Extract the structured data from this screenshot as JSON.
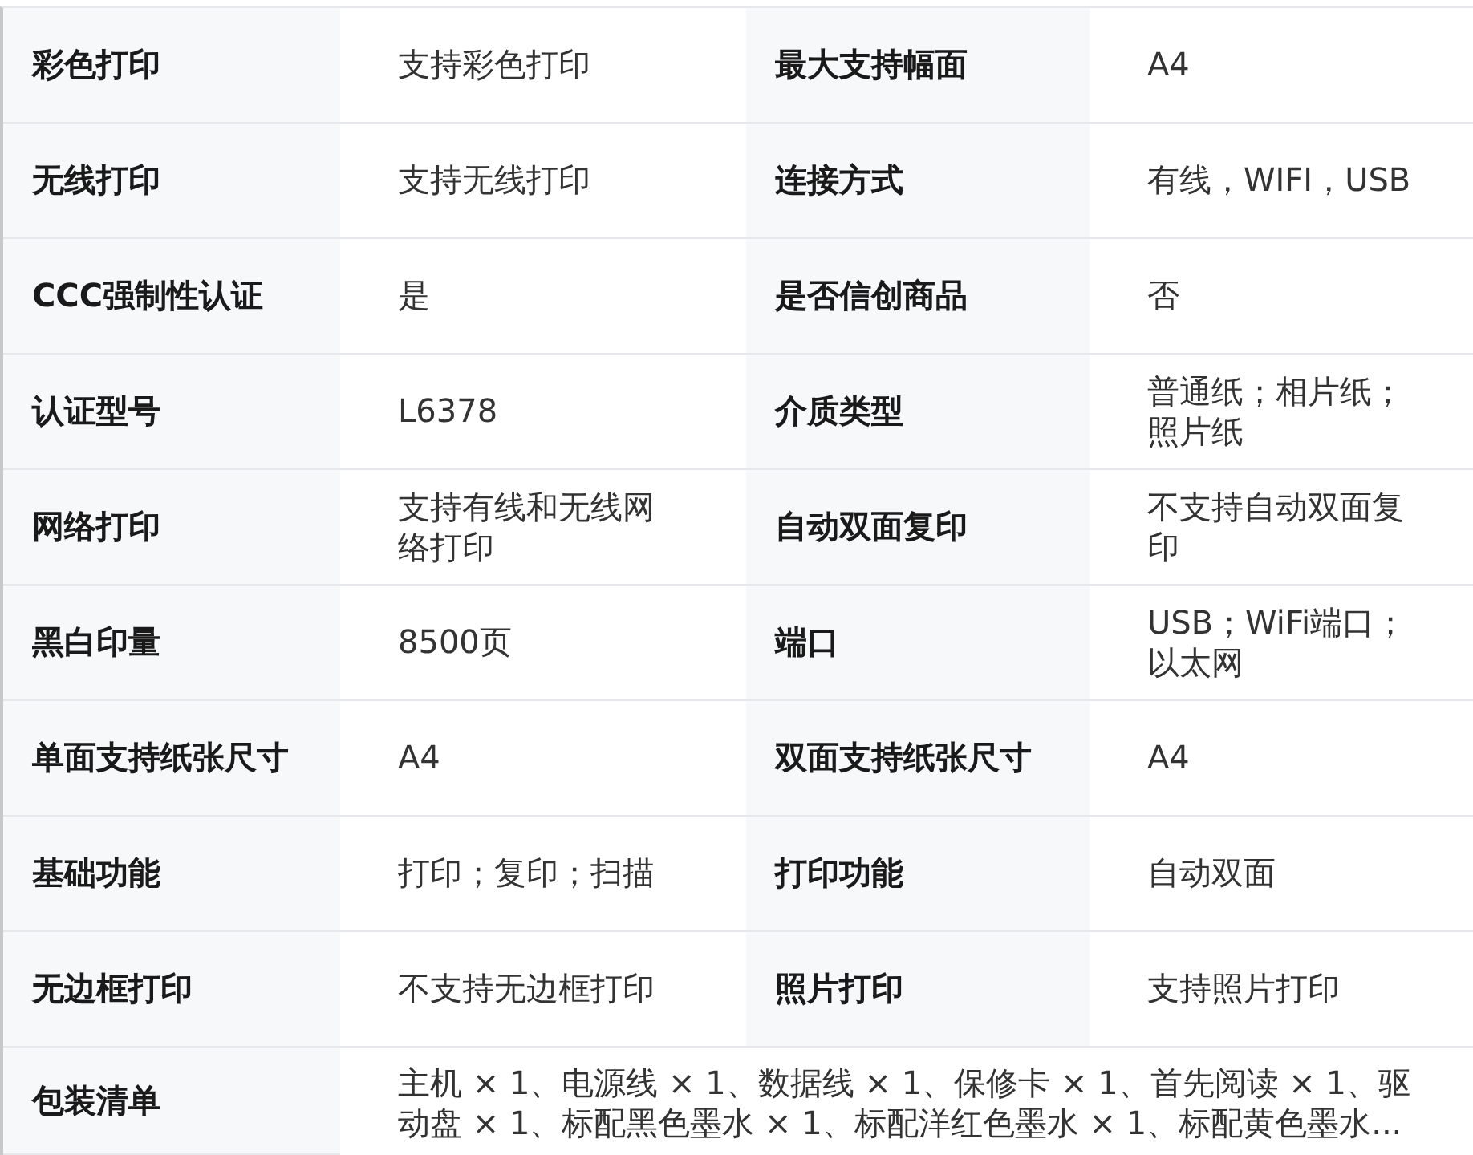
{
  "specs": [
    {
      "label": "彩色打印",
      "value": "支持彩色打印"
    },
    {
      "label": "最大支持幅面",
      "value": "A4"
    },
    {
      "label": "无线打印",
      "value": "支持无线打印"
    },
    {
      "label": "连接方式",
      "value": "有线，WIFI，USB"
    },
    {
      "label": "CCC强制性认证",
      "value": "是"
    },
    {
      "label": "是否信创商品",
      "value": "否"
    },
    {
      "label": "认证型号",
      "value": "L6378"
    },
    {
      "label": "介质类型",
      "value": "普通纸；相片纸；照片纸"
    },
    {
      "label": "网络打印",
      "value": "支持有线和无线网络打印"
    },
    {
      "label": "自动双面复印",
      "value": "不支持自动双面复印"
    },
    {
      "label": "黑白印量",
      "value": "8500页"
    },
    {
      "label": "端口",
      "value": "USB；WiFi端口；以太网"
    },
    {
      "label": "单面支持纸张尺寸",
      "value": "A4"
    },
    {
      "label": "双面支持纸张尺寸",
      "value": "A4"
    },
    {
      "label": "基础功能",
      "value": "打印；复印；扫描"
    },
    {
      "label": "打印功能",
      "value": "自动双面"
    },
    {
      "label": "无边框打印",
      "value": "不支持无边框打印"
    },
    {
      "label": "照片打印",
      "value": "支持照片打印"
    }
  ],
  "package": {
    "label": "包装清单",
    "value": "主机 × 1、电源线 × 1、数据线 × 1、保修卡 × 1、首先阅读 × 1、驱动盘 × 1、标配黑色墨水 × 1、标配洋红色墨水 × 1、标配黄色墨水..."
  }
}
